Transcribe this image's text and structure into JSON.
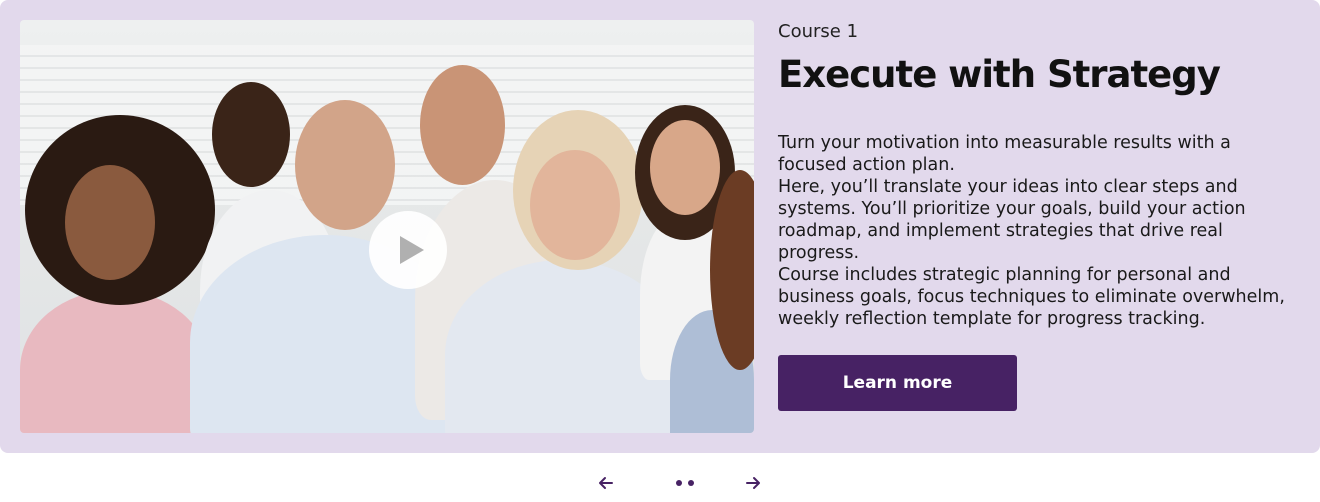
{
  "course": {
    "eyebrow": "Course 1",
    "title": "Execute with Strategy",
    "paragraphs": [
      "Turn your motivation into measurable results with a focused action plan.",
      "Here, you’ll translate your ideas into clear steps and systems. You’ll prioritize your goals, build your action roadmap, and implement strategies that drive real progress.",
      "Course includes strategic planning for personal and business goals, focus techniques to eliminate overwhelm, weekly reflection template for progress tracking."
    ],
    "cta_label": "Learn more"
  },
  "media": {
    "play_icon": "play-icon"
  },
  "carousel": {
    "prev_icon": "arrow-left-icon",
    "next_icon": "arrow-right-icon",
    "dots": 2
  },
  "colors": {
    "card_bg": "#e2d9ec",
    "accent": "#472264"
  }
}
